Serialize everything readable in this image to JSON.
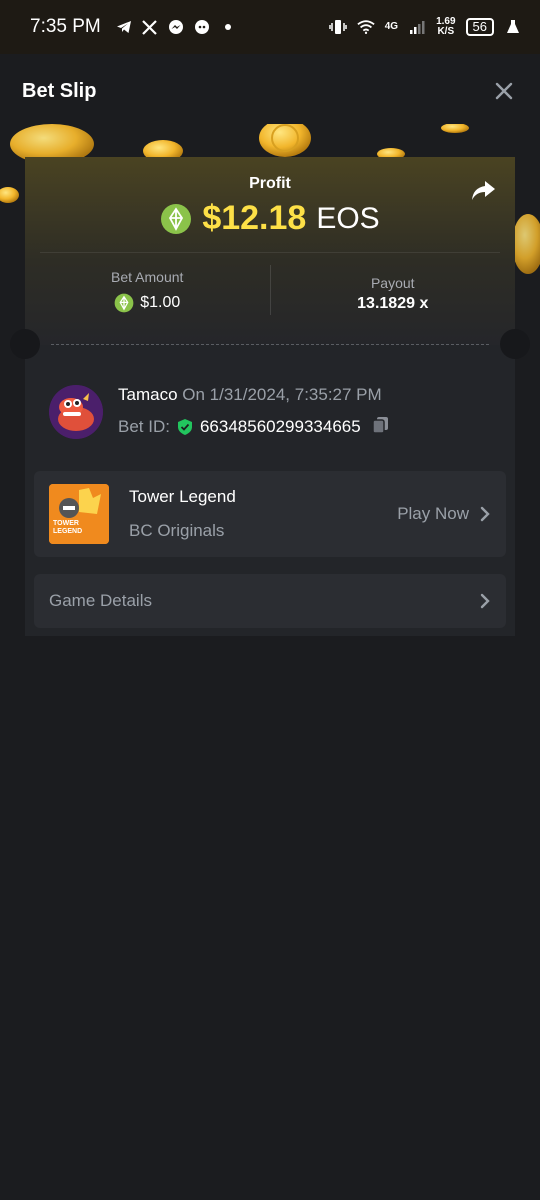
{
  "status_bar": {
    "time": "7:35 PM",
    "network": "4G",
    "speed_value": "1.69",
    "speed_unit": "K/S",
    "battery": "56"
  },
  "header": {
    "title": "Bet Slip"
  },
  "profit": {
    "label": "Profit",
    "amount": "$12.18",
    "currency": "EOS"
  },
  "bet_amount": {
    "label": "Bet Amount",
    "value": "$1.00"
  },
  "payout": {
    "label": "Payout",
    "value": "13.1829 x"
  },
  "user": {
    "name": "Tamaco",
    "date": "On 1/31/2024, 7:35:27 PM",
    "bet_id_label": "Bet ID:",
    "bet_id": "66348560299334665"
  },
  "game": {
    "name": "Tower Legend",
    "provider": "BC Originals",
    "play_label": "Play Now",
    "thumb_text_1": "TOWER",
    "thumb_text_2": "LEGEND"
  },
  "details": {
    "label": "Game Details"
  },
  "colors": {
    "accent_yellow": "#fde047",
    "eos_green": "#8bc34a",
    "verified_green": "#22c55e"
  }
}
